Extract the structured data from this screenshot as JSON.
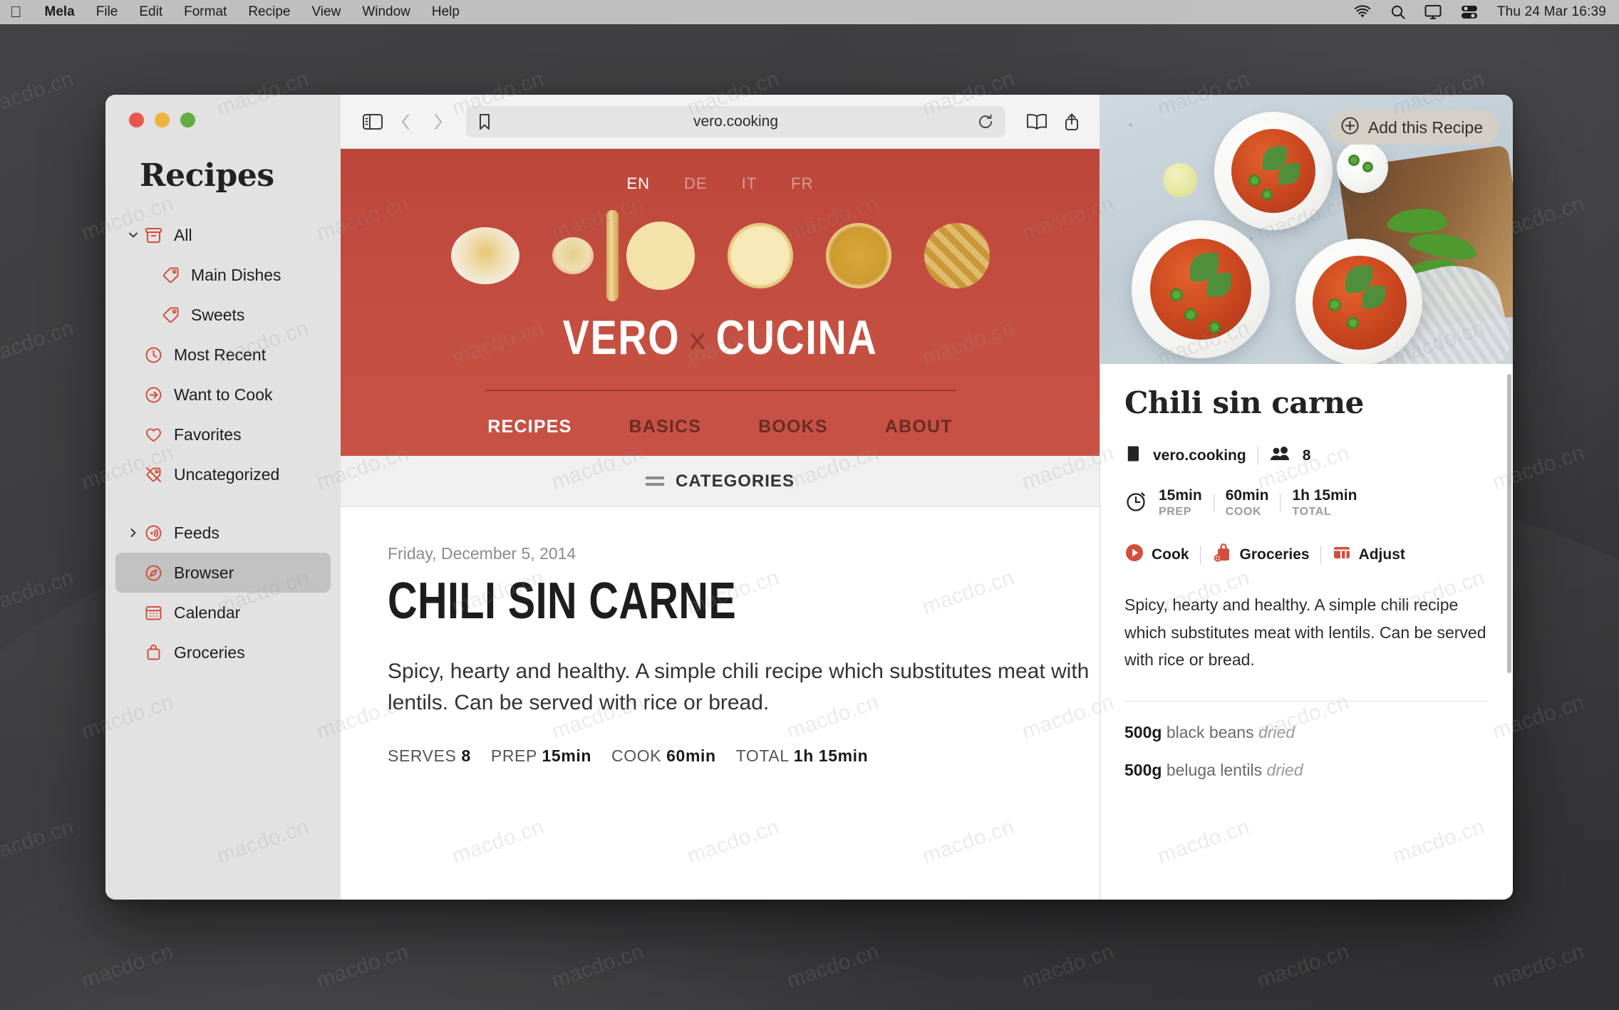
{
  "menubar": {
    "apple_icon": "apple-logo",
    "items": [
      "Mela",
      "File",
      "Edit",
      "Format",
      "Recipe",
      "View",
      "Window",
      "Help"
    ],
    "status_icons": [
      "wifi-icon",
      "search-icon",
      "display-icon",
      "control-center-icon"
    ],
    "clock": "Thu 24 Mar  16:39"
  },
  "sidebar": {
    "title": "Recipes",
    "items": [
      {
        "label": "All",
        "icon": "archive-box-icon",
        "disclosure": "chevron-down-icon",
        "child": false,
        "selected": false
      },
      {
        "label": "Main Dishes",
        "icon": "tag-icon",
        "disclosure": "",
        "child": true,
        "selected": false
      },
      {
        "label": "Sweets",
        "icon": "tag-icon",
        "disclosure": "",
        "child": true,
        "selected": false
      },
      {
        "label": "Most Recent",
        "icon": "clock-icon",
        "disclosure": "",
        "child": false,
        "selected": false
      },
      {
        "label": "Want to Cook",
        "icon": "arrow-right-circle-icon",
        "disclosure": "",
        "child": false,
        "selected": false
      },
      {
        "label": "Favorites",
        "icon": "heart-icon",
        "disclosure": "",
        "child": false,
        "selected": false
      },
      {
        "label": "Uncategorized",
        "icon": "tag-slash-icon",
        "disclosure": "",
        "child": false,
        "selected": false
      }
    ],
    "items2": [
      {
        "label": "Feeds",
        "icon": "broadcast-icon",
        "disclosure": "chevron-right-icon",
        "child": false,
        "selected": false
      },
      {
        "label": "Browser",
        "icon": "compass-icon",
        "disclosure": "",
        "child": false,
        "selected": true
      },
      {
        "label": "Calendar",
        "icon": "calendar-icon",
        "disclosure": "",
        "child": false,
        "selected": false
      },
      {
        "label": "Groceries",
        "icon": "basket-icon",
        "disclosure": "",
        "child": false,
        "selected": false
      }
    ]
  },
  "browser": {
    "toolbar": {
      "sidebar_toggle": "sidebar-toggle-icon",
      "back": "chevron-left-icon",
      "forward": "chevron-right-icon",
      "bookmark": "bookmark-icon",
      "url": "vero.cooking",
      "reload": "reload-icon",
      "reader": "reader-book-icon",
      "share": "share-icon"
    },
    "site": {
      "languages": [
        "EN",
        "DE",
        "IT",
        "FR"
      ],
      "active_language": "EN",
      "logo_left": "VERO",
      "logo_x": "×",
      "logo_right": "CUCINA",
      "nav": [
        "RECIPES",
        "BASICS",
        "BOOKS",
        "ABOUT"
      ],
      "active_nav": "RECIPES",
      "categories_label": "CATEGORIES",
      "categories_icon": "hamburger-icon"
    },
    "article": {
      "date": "Friday, December 5, 2014",
      "title": "CHILI SIN CARNE",
      "body": "Spicy, hearty and healthy. A simple chili recipe which substitutes meat with lentils. Can be served with rice or bread.",
      "meta": [
        {
          "key": "SERVES",
          "value": "8"
        },
        {
          "key": "PREP",
          "value": "15min"
        },
        {
          "key": "COOK",
          "value": "60min"
        },
        {
          "key": "TOTAL",
          "value": "1h 15min"
        }
      ]
    }
  },
  "detail": {
    "add_button": {
      "label": "Add this Recipe",
      "icon": "plus-circle-icon"
    },
    "photo_alt": "three-bowls-of-chili-photo",
    "title": "Chili sin carne",
    "source": {
      "icon": "book-icon",
      "label": "vero.cooking"
    },
    "servings": {
      "icon": "people-icon",
      "value": "8"
    },
    "times": [
      {
        "value": "15min",
        "key": "PREP"
      },
      {
        "value": "60min",
        "key": "COOK"
      },
      {
        "value": "1h 15min",
        "key": "TOTAL"
      }
    ],
    "times_icon": "timer-icon",
    "actions": [
      {
        "label": "Cook",
        "icon": "play-circle-icon"
      },
      {
        "label": "Groceries",
        "icon": "groceries-bag-icon"
      },
      {
        "label": "Adjust",
        "icon": "adjust-icon"
      }
    ],
    "description": "Spicy, hearty and healthy. A simple chili recipe which substitutes meat with lentils. Can be served with rice or bread.",
    "ingredients": [
      {
        "amount": "500g",
        "name": "black beans",
        "note": "dried"
      },
      {
        "amount": "500g",
        "name": "beluga lentils",
        "note": "dried"
      }
    ]
  },
  "watermark": "macdo.cn",
  "colors": {
    "accent_red": "#d0503c",
    "site_red": "#c44a3c",
    "sidebar_bg": "#e2e2e2"
  }
}
